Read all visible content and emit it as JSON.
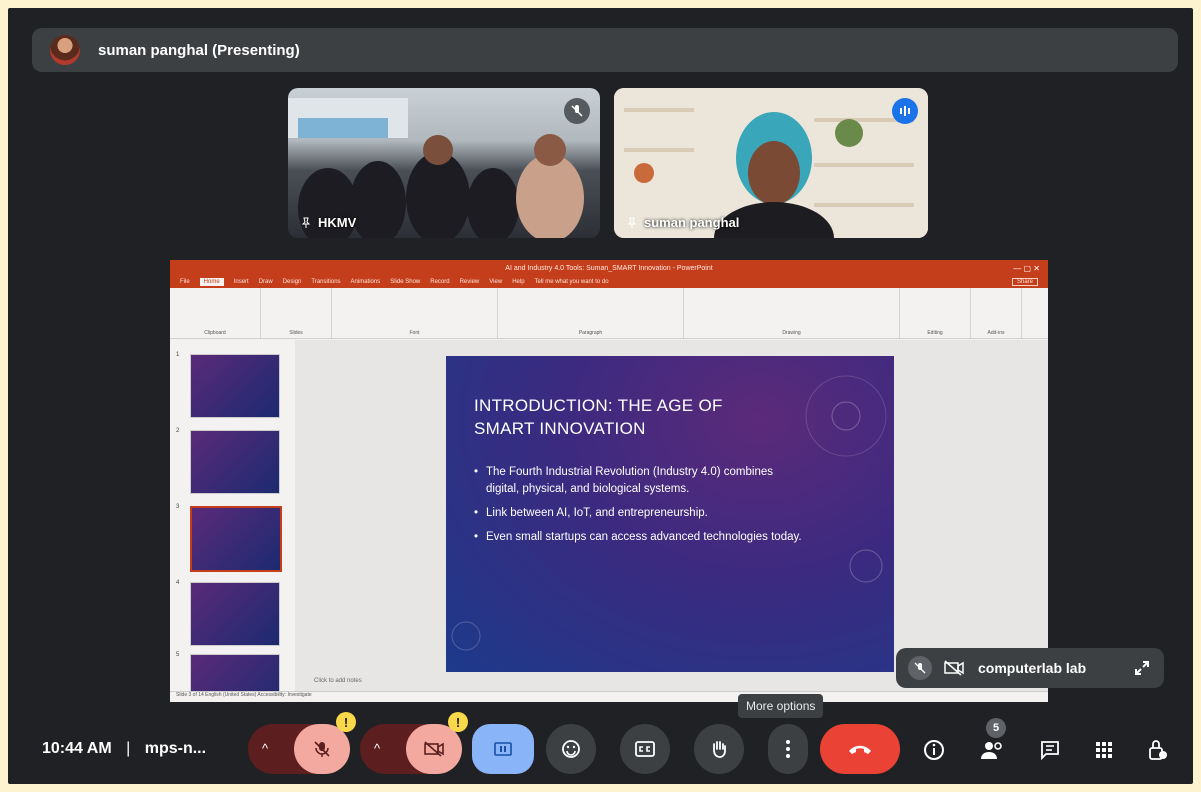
{
  "presenter": {
    "name": "suman panghal (Presenting)"
  },
  "tiles": [
    {
      "name": "HKMV",
      "status": "muted"
    },
    {
      "name": "suman panghal",
      "status": "speaking"
    }
  ],
  "powerpoint": {
    "window_title": "AI and Industry 4.0 Tools: Suman_SMART Innovation - PowerPoint",
    "tabs": [
      "File",
      "Home",
      "Insert",
      "Draw",
      "Design",
      "Transitions",
      "Animations",
      "Slide Show",
      "Record",
      "Review",
      "View",
      "Help"
    ],
    "active_tab": "Home",
    "tell_me": "Tell me what you want to do",
    "share_label": "Share",
    "ribbon_groups": [
      "Clipboard",
      "Slides",
      "Font",
      "Paragraph",
      "Drawing",
      "Editing",
      "Add-ins"
    ],
    "thumbnail_numbers": [
      "1",
      "2",
      "3",
      "4",
      "5"
    ],
    "slide": {
      "title_line1": "INTRODUCTION: THE AGE OF",
      "title_line2": "SMART INNOVATION",
      "bullets": [
        "The Fourth Industrial Revolution (Industry 4.0) combines digital, physical, and biological systems.",
        "Link between AI, IoT, and entrepreneurship.",
        "Even small startups can access advanced technologies today."
      ]
    },
    "notes_placeholder": "Click to add notes",
    "status_text": "Slide 3 of 14    English (United States)    Accessibility: Investigate"
  },
  "self_view": {
    "name": "computerlab lab"
  },
  "tooltip": "More options",
  "bottom_bar": {
    "time": "10:44 AM",
    "separator": "|",
    "meeting_code": "mps-n...",
    "participant_count": "5"
  },
  "colors": {
    "accent_red": "#ea4335",
    "dark_red": "#5c1e1e",
    "muted_pink": "#f4a9a0",
    "present_blue": "#8ab4f8",
    "warning_yellow": "#f9d949"
  }
}
